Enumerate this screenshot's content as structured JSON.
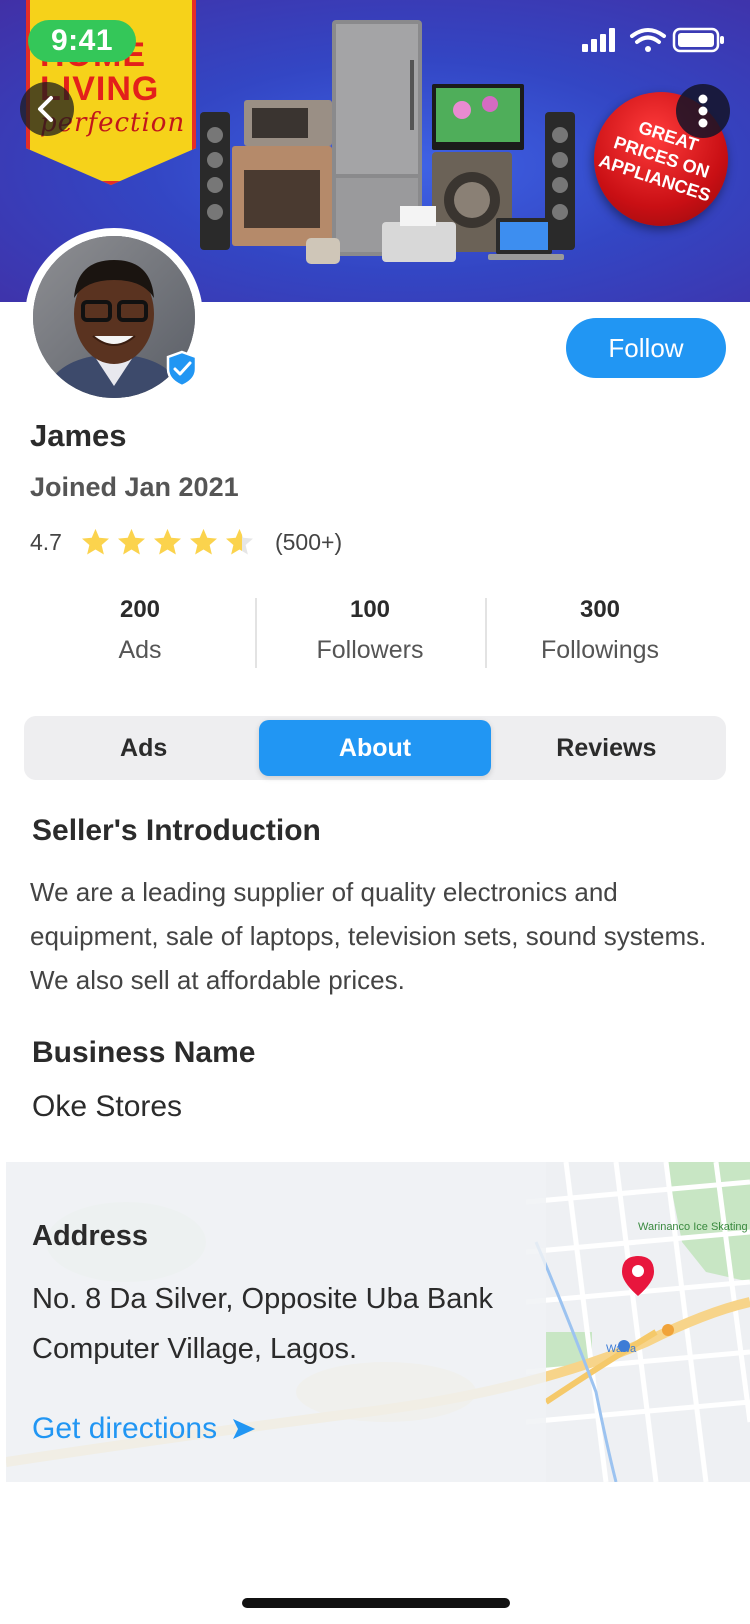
{
  "status_bar": {
    "time": "9:41"
  },
  "banner": {
    "promo_line1": "HOME",
    "promo_line2": "LIVING",
    "promo_line3": "perfection",
    "seal_line1": "GREAT",
    "seal_line2": "PRICES ON",
    "seal_line3": "APPLIANCES"
  },
  "profile": {
    "follow_label": "Follow",
    "name": "James",
    "joined": "Joined Jan 2021",
    "rating": "4.7",
    "rating_value": 4.7,
    "rating_count": "(500+)",
    "verified": true
  },
  "stats": [
    {
      "value": "200",
      "label": "Ads"
    },
    {
      "value": "100",
      "label": "Followers"
    },
    {
      "value": "300",
      "label": "Followings"
    }
  ],
  "tabs": [
    {
      "label": "Ads",
      "active": false
    },
    {
      "label": "About",
      "active": true
    },
    {
      "label": "Reviews",
      "active": false
    }
  ],
  "about": {
    "intro_title": "Seller's Introduction",
    "intro_text": "We are a leading supplier of quality electronics and equipment, sale of laptops, television sets, sound systems. We also sell at affordable prices.",
    "business_title": "Business Name",
    "business_name": "Oke Stores",
    "address_title": "Address",
    "address_line1": "No. 8 Da Silver, Opposite Uba Bank",
    "address_line2": "Computer Village, Lagos.",
    "directions_label": "Get directions"
  },
  "map": {
    "poi_skating": "Warinanco Ice Skating Center",
    "poi_wawa": "Wawa"
  },
  "colors": {
    "accent": "#2196f3",
    "star": "#fbd34d",
    "verified": "#2196f3",
    "status_pill": "#34c759",
    "map_pin": "#e8163d"
  }
}
